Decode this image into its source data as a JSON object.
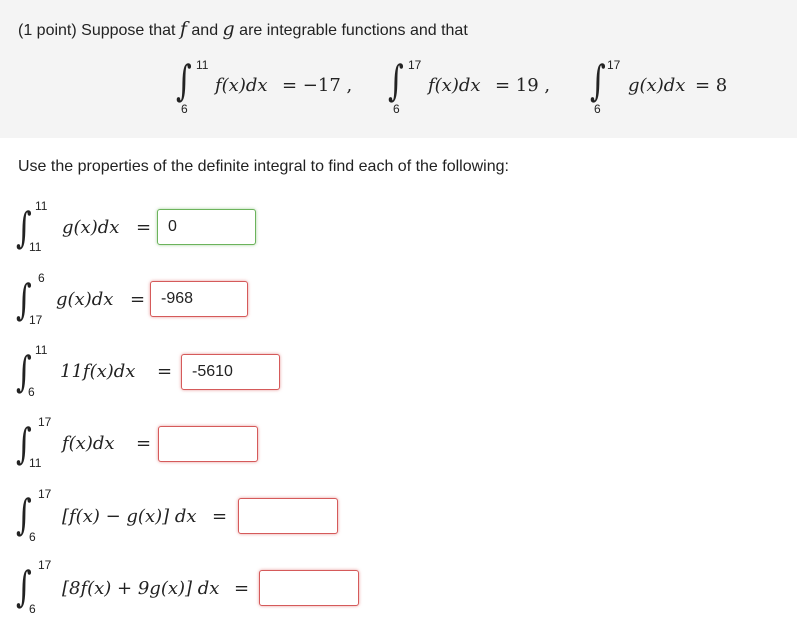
{
  "problem": {
    "header": "(1 point) Suppose that",
    "f": "f",
    "and_text": "and",
    "g": "g",
    "tail": "are integrable functions and that"
  },
  "given": [
    {
      "lower": "6",
      "upper": "11",
      "expr": "f(x)dx",
      "rhs": "= −17 ,"
    },
    {
      "lower": "6",
      "upper": "17",
      "expr": "f(x)dx",
      "rhs": "= 19 ,"
    },
    {
      "lower": "6",
      "upper": "17",
      "expr": "g(x)dx",
      "rhs": "= 8"
    }
  ],
  "instructions": "Use the properties of the definite integral to find each of the following:",
  "questions": [
    {
      "lower": "11",
      "upper": "11",
      "expr": "g(x)dx",
      "eq": "=",
      "answer": "0",
      "status": "correct"
    },
    {
      "lower": "17",
      "upper": "6",
      "expr": "g(x)dx",
      "eq": "=",
      "answer": "-968",
      "status": "incorrect"
    },
    {
      "lower": "6",
      "upper": "11",
      "expr": "11f(x)dx",
      "eq": "=",
      "answer": "-5610",
      "status": "incorrect"
    },
    {
      "lower": "11",
      "upper": "17",
      "expr": "f(x)dx",
      "eq": "=",
      "answer": "",
      "status": "incorrect"
    },
    {
      "lower": "6",
      "upper": "17",
      "expr": "[f(x) − g(x)] dx",
      "eq": "=",
      "answer": "",
      "status": "incorrect"
    },
    {
      "lower": "6",
      "upper": "17",
      "expr": "[8f(x) + 9g(x)] dx",
      "eq": "=",
      "answer": "",
      "status": "incorrect"
    }
  ],
  "colors": {
    "correct": "#6cb35c",
    "incorrect": "#d55a5a",
    "panel": "#f4f4f4"
  }
}
